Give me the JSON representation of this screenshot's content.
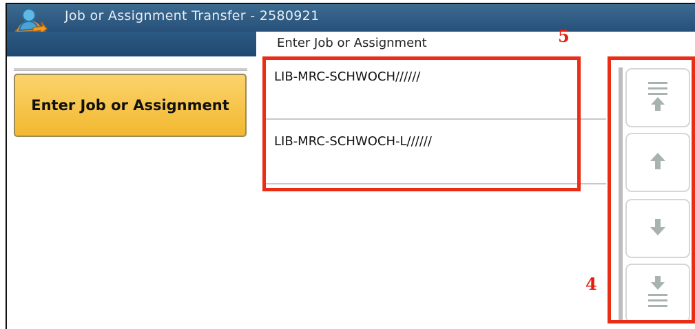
{
  "window": {
    "title": "Job or Assignment Transfer  -  2580921",
    "icon": "user-transfer-icon"
  },
  "section_label": "Enter Job or Assignment",
  "left_panel": {
    "enter_button_label": "Enter Job or Assignment"
  },
  "job_list": {
    "items": [
      {
        "label": "LIB-MRC-SCHWOCH//////"
      },
      {
        "label": "LIB-MRC-SCHWOCH-L//////"
      }
    ]
  },
  "scroll_controls": {
    "buttons": [
      {
        "icon": "scroll-to-top-icon",
        "enabled": false
      },
      {
        "icon": "scroll-up-icon",
        "enabled": false
      },
      {
        "icon": "scroll-down-icon",
        "enabled": false
      },
      {
        "icon": "scroll-to-bottom-icon",
        "enabled": false
      }
    ]
  },
  "annotations": {
    "list_marker": "5",
    "scroll_marker": "4",
    "highlight_color": "#ea2d17"
  },
  "colors": {
    "titlebar": "#2f5d85",
    "button_accent": "#f5c142",
    "disabled_icon": "#a9b3ad"
  }
}
